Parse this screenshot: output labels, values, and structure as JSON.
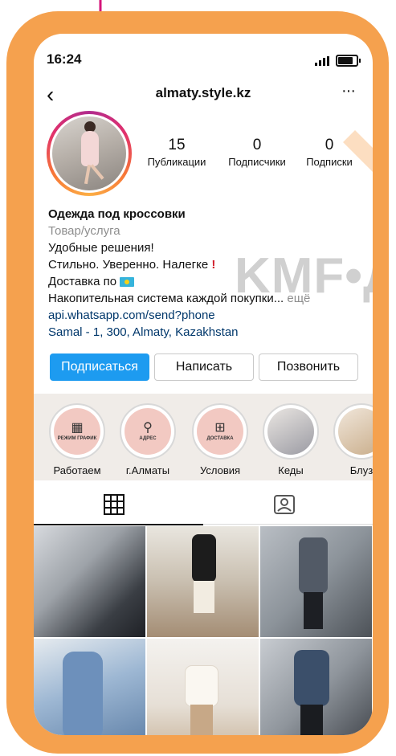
{
  "status": {
    "time": "16:24"
  },
  "nav": {
    "back": "‹",
    "username": "almaty.style.kz",
    "more": "···"
  },
  "stats": [
    {
      "num": "15",
      "label": "Публикации"
    },
    {
      "num": "0",
      "label": "Подписчики"
    },
    {
      "num": "0",
      "label": "Подписки"
    }
  ],
  "bio": {
    "name": "Одежда под кроссовки",
    "category": "Товар/услуга",
    "line1": "Удобные решения!",
    "line2": "Стильно. Уверенно. Налегке",
    "line3": "Доставка по",
    "line4": "Накопительная система каждой покупки...",
    "more": "ещё",
    "link": "api.whatsapp.com/send?phone",
    "address": "Samal - 1, 300, Almaty, Kazakhstan"
  },
  "buttons": {
    "follow": "Подписаться",
    "message": "Написать",
    "call": "Позвонить"
  },
  "highlights": [
    {
      "label": "Работаем",
      "icon_text": "РЕЖИМ ГРАФИК",
      "icon": "calendar-icon"
    },
    {
      "label": "г.Алматы",
      "icon_text": "АДРЕС",
      "icon": "location-pin-icon"
    },
    {
      "label": "Условия",
      "icon_text": "ДОСТАВКА",
      "icon": "cart-icon"
    },
    {
      "label": "Кеды",
      "icon_text": "",
      "icon": "sneakers-photo"
    },
    {
      "label": "Блуз",
      "icon_text": "",
      "icon": "blouse-photo"
    }
  ],
  "watermark": "KMF•Д",
  "colors": {
    "frame": "#f5a14e",
    "accent": "#1d9bf0",
    "link": "#00376b"
  }
}
